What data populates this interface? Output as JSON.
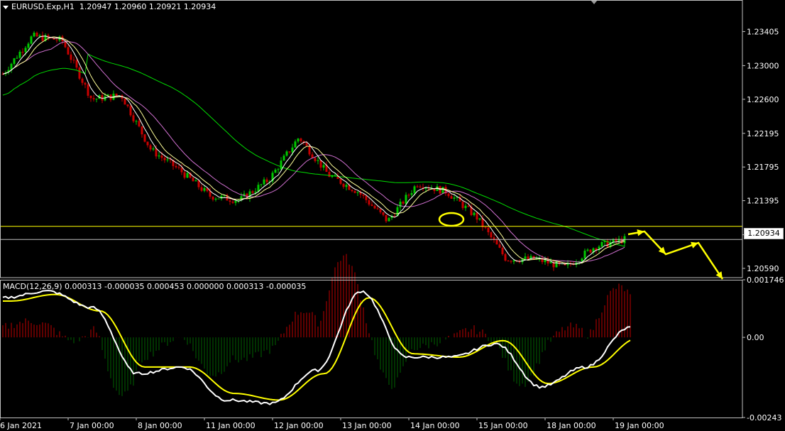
{
  "header": {
    "symbol": "EURUSD.Exp,H1",
    "ohlc": "1.20947 1.20960 1.20921 1.20934"
  },
  "macd": {
    "title": "MACD(12,26,9) 0.000313 -0.000035 0.000453 0.000000 0.000313 -0.000035"
  },
  "current_price_label": "1.20934",
  "colors": {
    "background": "#000000",
    "bull_candle": "#00c800",
    "bear_candle": "#c80000",
    "ma_fast": "#ffffff",
    "ma_mid": "#ffff99",
    "ma_slow": "#d070d0",
    "ma_long": "#00dc00",
    "level_line": "#ffff00",
    "price_line": "#c0c0c0",
    "macd_line": "#ffffff",
    "signal_line": "#ffff00",
    "hist_pos": "#c00000",
    "hist_neg": "#006400",
    "annotation": "#ffff00"
  },
  "chart_data": [
    {
      "type": "candlestick",
      "title": "EURUSD.Exp,H1",
      "timeframe": "H1",
      "y_ticks": [
        "1.23405",
        "1.23000",
        "1.22600",
        "1.22195",
        "1.21795",
        "1.21395",
        "1.20990",
        "1.20590"
      ],
      "ylim": [
        1.2048,
        1.2378
      ],
      "current_price": 1.20934,
      "support_level": 1.2109,
      "x_ticks": [
        "6 Jan 2021",
        "7 Jan 00:00",
        "8 Jan 00:00",
        "11 Jan 00:00",
        "12 Jan 00:00",
        "13 Jan 00:00",
        "14 Jan 00:00",
        "15 Jan 00:00",
        "18 Jan 00:00",
        "19 Jan 00:00"
      ],
      "approx_close_path": [
        {
          "x": "6 Jan 2021",
          "close": 1.229
        },
        {
          "x": "6 Jan 12:00",
          "close": 1.2335
        },
        {
          "x": "7 Jan 00:00",
          "close": 1.233
        },
        {
          "x": "7 Jan 12:00",
          "close": 1.226
        },
        {
          "x": "8 Jan 00:00",
          "close": 1.2265
        },
        {
          "x": "8 Jan 12:00",
          "close": 1.22
        },
        {
          "x": "11 Jan 00:00",
          "close": 1.2175
        },
        {
          "x": "11 Jan 12:00",
          "close": 1.2145
        },
        {
          "x": "12 Jan 00:00",
          "close": 1.214
        },
        {
          "x": "12 Jan 12:00",
          "close": 1.2165
        },
        {
          "x": "13 Jan 00:00",
          "close": 1.2215
        },
        {
          "x": "13 Jan 12:00",
          "close": 1.217
        },
        {
          "x": "14 Jan 00:00",
          "close": 1.215
        },
        {
          "x": "14 Jan 06:00",
          "close": 1.2115
        },
        {
          "x": "14 Jan 18:00",
          "close": 1.216
        },
        {
          "x": "15 Jan 00:00",
          "close": 1.215
        },
        {
          "x": "15 Jan 12:00",
          "close": 1.212
        },
        {
          "x": "15 Jan 20:00",
          "close": 1.207
        },
        {
          "x": "18 Jan 00:00",
          "close": 1.207
        },
        {
          "x": "18 Jan 12:00",
          "close": 1.206
        },
        {
          "x": "19 Jan 00:00",
          "close": 1.2085
        },
        {
          "x": "19 Jan 06:00",
          "close": 1.20934
        }
      ]
    },
    {
      "type": "line",
      "title": "MACD(12,26,9) 0.000313 -0.000035 0.000453 0.000000 0.000313 -0.000035",
      "y_ticks": [
        "0.001746",
        "0.00",
        "-0.00243"
      ],
      "ylim": [
        -0.00243,
        0.001746
      ],
      "series": [
        {
          "name": "MACD",
          "values": [
            0.0012,
            0.0014,
            0.0009,
            -0.0011,
            -0.0009,
            -0.0019,
            -0.002,
            -0.001,
            0.0014,
            -0.0006,
            -0.0006,
            -0.0002,
            -0.0015,
            -0.0009,
            0.0003
          ]
        },
        {
          "name": "Signal",
          "values": [
            0.0011,
            0.0013,
            0.0008,
            -0.0009,
            -0.0009,
            -0.0017,
            -0.0019,
            -0.0011,
            0.0012,
            -0.0005,
            -0.0006,
            -0.0001,
            -0.0014,
            -0.0009,
            -3e-05
          ]
        }
      ]
    }
  ]
}
